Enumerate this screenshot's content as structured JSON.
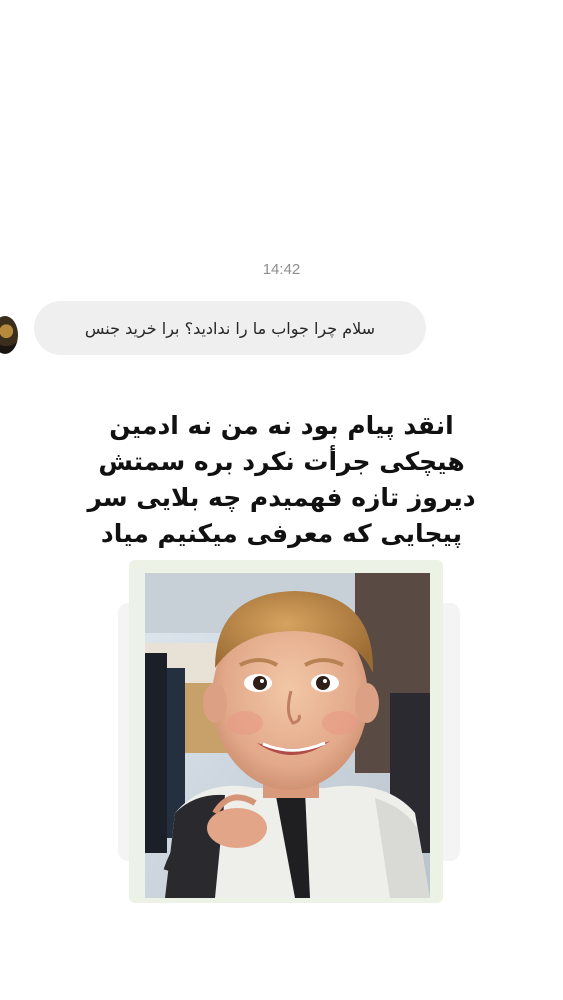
{
  "conversation": {
    "timestamp": "14:42",
    "incoming_message": {
      "text": "سلام چرا جواب ما را ندادید؟ برا خرید جنس"
    }
  },
  "story_share": {
    "caption_lines": [
      "انقد پیام بود نه من نه ادمین",
      "هیچکی جرأت نکرد بره سمتش",
      "دیروز تازه فهمیدم چه بلایی سر",
      "پیجایی که معرفی میکنیم میاد"
    ],
    "image": {
      "subject": "smiling boy meme photo"
    }
  },
  "colors": {
    "background": "#ffffff",
    "bubble_bg": "#efefef",
    "timestamp": "#8e8e8e",
    "message_text": "#262626",
    "caption_text": "#111111"
  }
}
